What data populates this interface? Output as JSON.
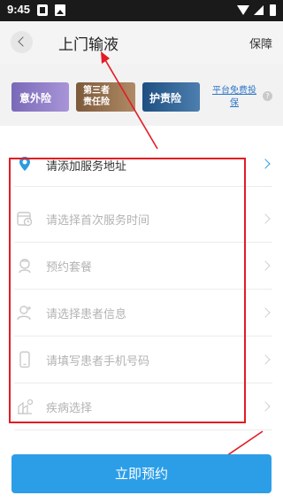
{
  "status_bar": {
    "time": "9:45"
  },
  "header": {
    "title": "上门输液",
    "right_label": "保障"
  },
  "insurance": {
    "items": [
      {
        "label": "意外险"
      },
      {
        "label_line1": "第三者",
        "label_line2": "责任险"
      },
      {
        "label": "护责险"
      }
    ],
    "link_text": "平台免费投保",
    "help_icon": "question-icon"
  },
  "form": {
    "rows": [
      {
        "label": "请添加服务地址",
        "icon": "location-pin-icon"
      },
      {
        "label": "请选择首次服务时间",
        "icon": "calendar-clock-icon"
      },
      {
        "label": "预约套餐",
        "icon": "nurse-icon"
      },
      {
        "label": "请选择患者信息",
        "icon": "patient-icon"
      },
      {
        "label": "请填写患者手机号码",
        "icon": "phone-icon"
      },
      {
        "label": "疾病选择",
        "icon": "disease-icon"
      }
    ]
  },
  "submit": {
    "label": "立即预约"
  },
  "colors": {
    "accent": "#2c9ee8",
    "annotation": "#e31b23"
  }
}
